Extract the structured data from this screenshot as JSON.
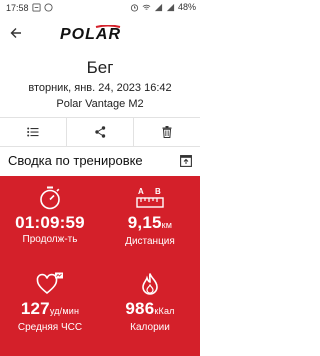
{
  "statusbar": {
    "time": "17:58",
    "battery": "48%"
  },
  "header": {
    "brand": "POLAR"
  },
  "workout": {
    "title": "Бег",
    "datetime": "вторник, янв. 24, 2023 16:42",
    "device": "Polar Vantage M2"
  },
  "actions": {
    "list": "list-icon",
    "share": "share-icon",
    "delete": "trash-icon"
  },
  "summary": {
    "title": "Сводка по тренировке",
    "duration": {
      "value": "01:09:59",
      "label": "Продолж-ть"
    },
    "distance": {
      "value": "9,15",
      "unit": "км",
      "label": "Дистанция"
    },
    "heart_rate": {
      "value": "127",
      "unit": "уд/мин",
      "label": "Средняя ЧСС"
    },
    "calories": {
      "value": "986",
      "unit": "кКал",
      "label": "Калории"
    }
  },
  "colors": {
    "accent": "#d4202a"
  }
}
